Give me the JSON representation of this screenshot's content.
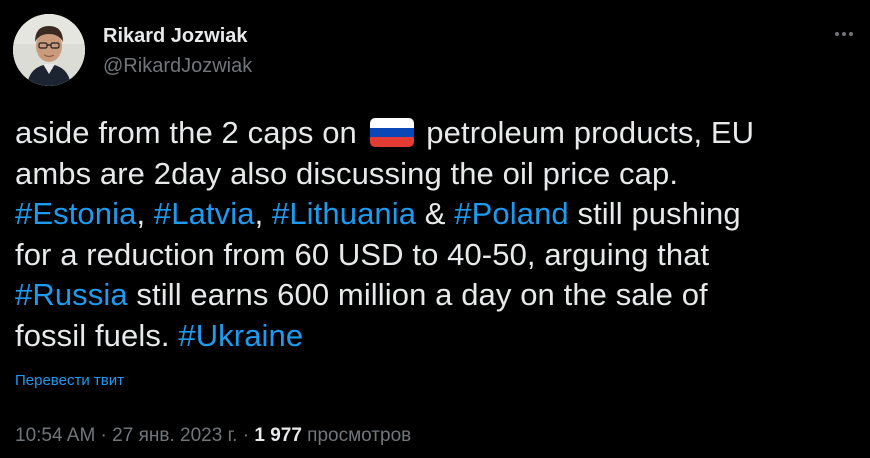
{
  "author": {
    "display_name": "Rikard Jozwiak",
    "handle": "@RikardJozwiak",
    "avatar_icon": "profile-photo"
  },
  "menu": {
    "more_icon": "more-horizontal-icon"
  },
  "tweet": {
    "line1_a": "aside from the 2 caps on ",
    "flag_icon": "russian-flag-emoji",
    "line1_b": " petroleum products, EU",
    "line2": "ambs are 2day also discussing the oil price cap.",
    "tag_estonia": "#Estonia",
    "sep1": ", ",
    "tag_latvia": "#Latvia",
    "sep2": ", ",
    "tag_lithuania": "#Lithuania",
    "sep3": " & ",
    "tag_poland": "#Poland",
    "line3_tail": " still pushing",
    "line4": "for a reduction from 60 USD to 40-50, arguing that",
    "tag_russia": "#Russia",
    "line5_tail": " still earns 600 million a day on the sale of",
    "line6": "fossil fuels. ",
    "tag_ukraine": "#Ukraine"
  },
  "translate_label": "Перевести твит",
  "meta": {
    "time": "10:54 AM",
    "dot1": " · ",
    "date": "27 янв. 2023 г.",
    "dot2": " · ",
    "views_count": "1 977",
    "views_label": " просмотров"
  },
  "colors": {
    "background": "#000000",
    "text": "#e7e9ea",
    "secondary": "#71767b",
    "link": "#1d9bf0"
  }
}
